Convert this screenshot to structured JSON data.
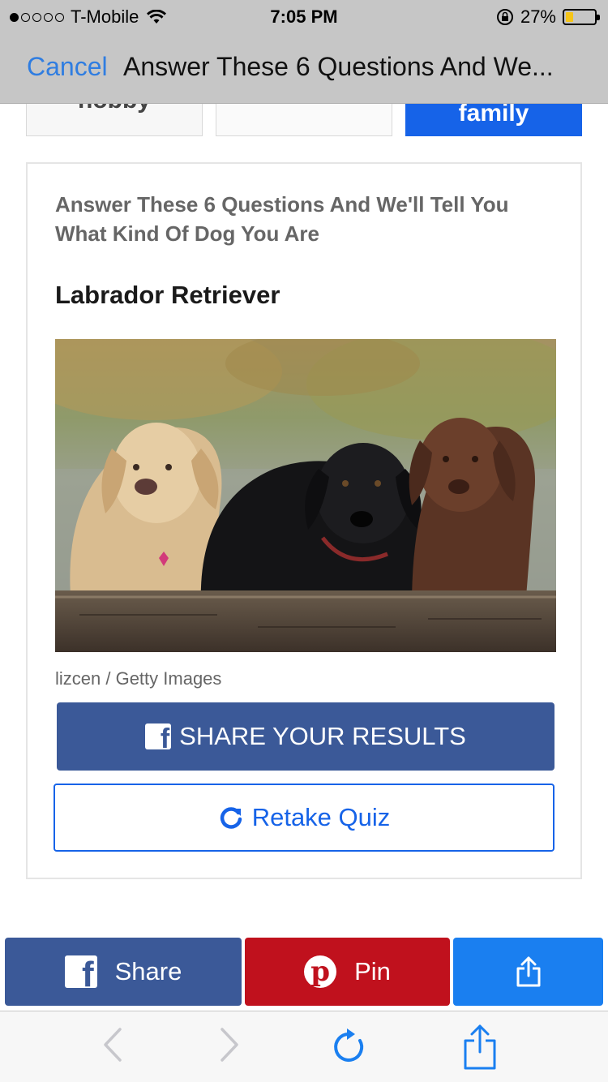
{
  "status_bar": {
    "carrier": "T-Mobile",
    "time": "7:05 PM",
    "battery_percent": "27%",
    "battery_level": 0.27,
    "icons": [
      "signal-dots-icon",
      "wifi-icon",
      "rotation-lock-icon",
      "battery-icon"
    ]
  },
  "nav": {
    "cancel_label": "Cancel",
    "title": "Answer These 6 Questions And We..."
  },
  "answer_options": [
    {
      "label": "hobby",
      "selected": false
    },
    {
      "label": "",
      "selected": false
    },
    {
      "label": "family",
      "selected": true
    }
  ],
  "result": {
    "quiz_title": "Answer These 6 Questions And We'll Tell You What Kind Of Dog You Are",
    "name": "Labrador Retriever",
    "photo": "three-labrador-retrievers-photo",
    "photo_credit": "lizcen / Getty Images",
    "share_label": "SHARE YOUR RESULTS",
    "retake_label": "Retake Quiz"
  },
  "share_bar": {
    "facebook_label": "Share",
    "pinterest_label": "Pin"
  },
  "colors": {
    "ios_blue": "#2f7de1",
    "facebook": "#3b5998",
    "pinterest": "#c0111d",
    "selected_option": "#1663e8",
    "share_more": "#1a7ff0"
  },
  "toolbar": {
    "icons": [
      "back-icon",
      "forward-icon",
      "reload-icon",
      "share-icon"
    ]
  }
}
